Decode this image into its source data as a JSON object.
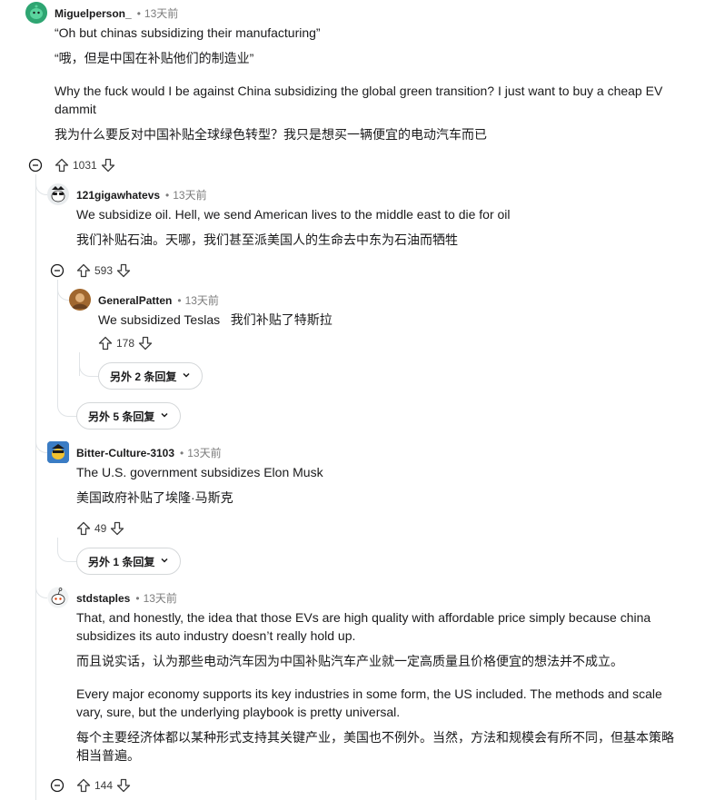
{
  "comments": [
    {
      "author": "Miguelperson_",
      "time": "13天前",
      "paragraphs": [
        "“Oh but chinas subsidizing their manufacturing”",
        "“哦，但是中国在补贴他们的制造业”",
        "Why the fuck would I be against China subsidizing the global green transition? I just want to buy a cheap EV dammit",
        "我为什么要反对中国补贴全球绿色转型？我只是想买一辆便宜的电动汽车而已"
      ],
      "votes": "1031"
    },
    {
      "author": "121gigawhatevs",
      "time": "13天前",
      "paragraphs": [
        "We subsidize oil. Hell, we send American lives to the middle east to die for oil",
        "我们补贴石油。天哪，我们甚至派美国人的生命去中东为石油而牺牲"
      ],
      "votes": "593"
    },
    {
      "author": "GeneralPatten",
      "time": "13天前",
      "paragraphs": [
        "We subsidized Teslas   我们补贴了特斯拉"
      ],
      "votes": "178",
      "more_replies": "另外 2 条回复"
    },
    {
      "author": "Bitter-Culture-3103",
      "time": "13天前",
      "paragraphs": [
        "The U.S. government subsidizes Elon Musk",
        "美国政府补贴了埃隆·马斯克"
      ],
      "votes": "49",
      "more_replies": "另外 1 条回复"
    },
    {
      "author": "stdstaples",
      "time": "13天前",
      "paragraphs": [
        "That, and honestly, the idea that those EVs are high quality with affordable price simply because china subsidizes its auto industry doesn’t really hold up.",
        "而且说实话，认为那些电动汽车因为中国补贴汽车产业就一定高质量且价格便宜的想法并不成立。",
        "Every major economy supports its key industries in some form, the US included. The methods and scale vary, sure, but the underlying playbook is pretty universal.",
        "每个主要经济体都以某种形式支持其关键产业，美国也不例外。当然，方法和规模会有所不同，但基本策略相当普遍。"
      ],
      "votes": "144"
    }
  ],
  "thread_more_replies": "另外 5 条回复",
  "colors": {
    "thread_line": "#e0e4e7",
    "meta_gray": "#7c7c7c",
    "avatar_green": "#3dbf8a"
  },
  "icons": [
    "collapse-icon",
    "upvote-icon",
    "downvote-icon",
    "chevron-down-icon"
  ]
}
